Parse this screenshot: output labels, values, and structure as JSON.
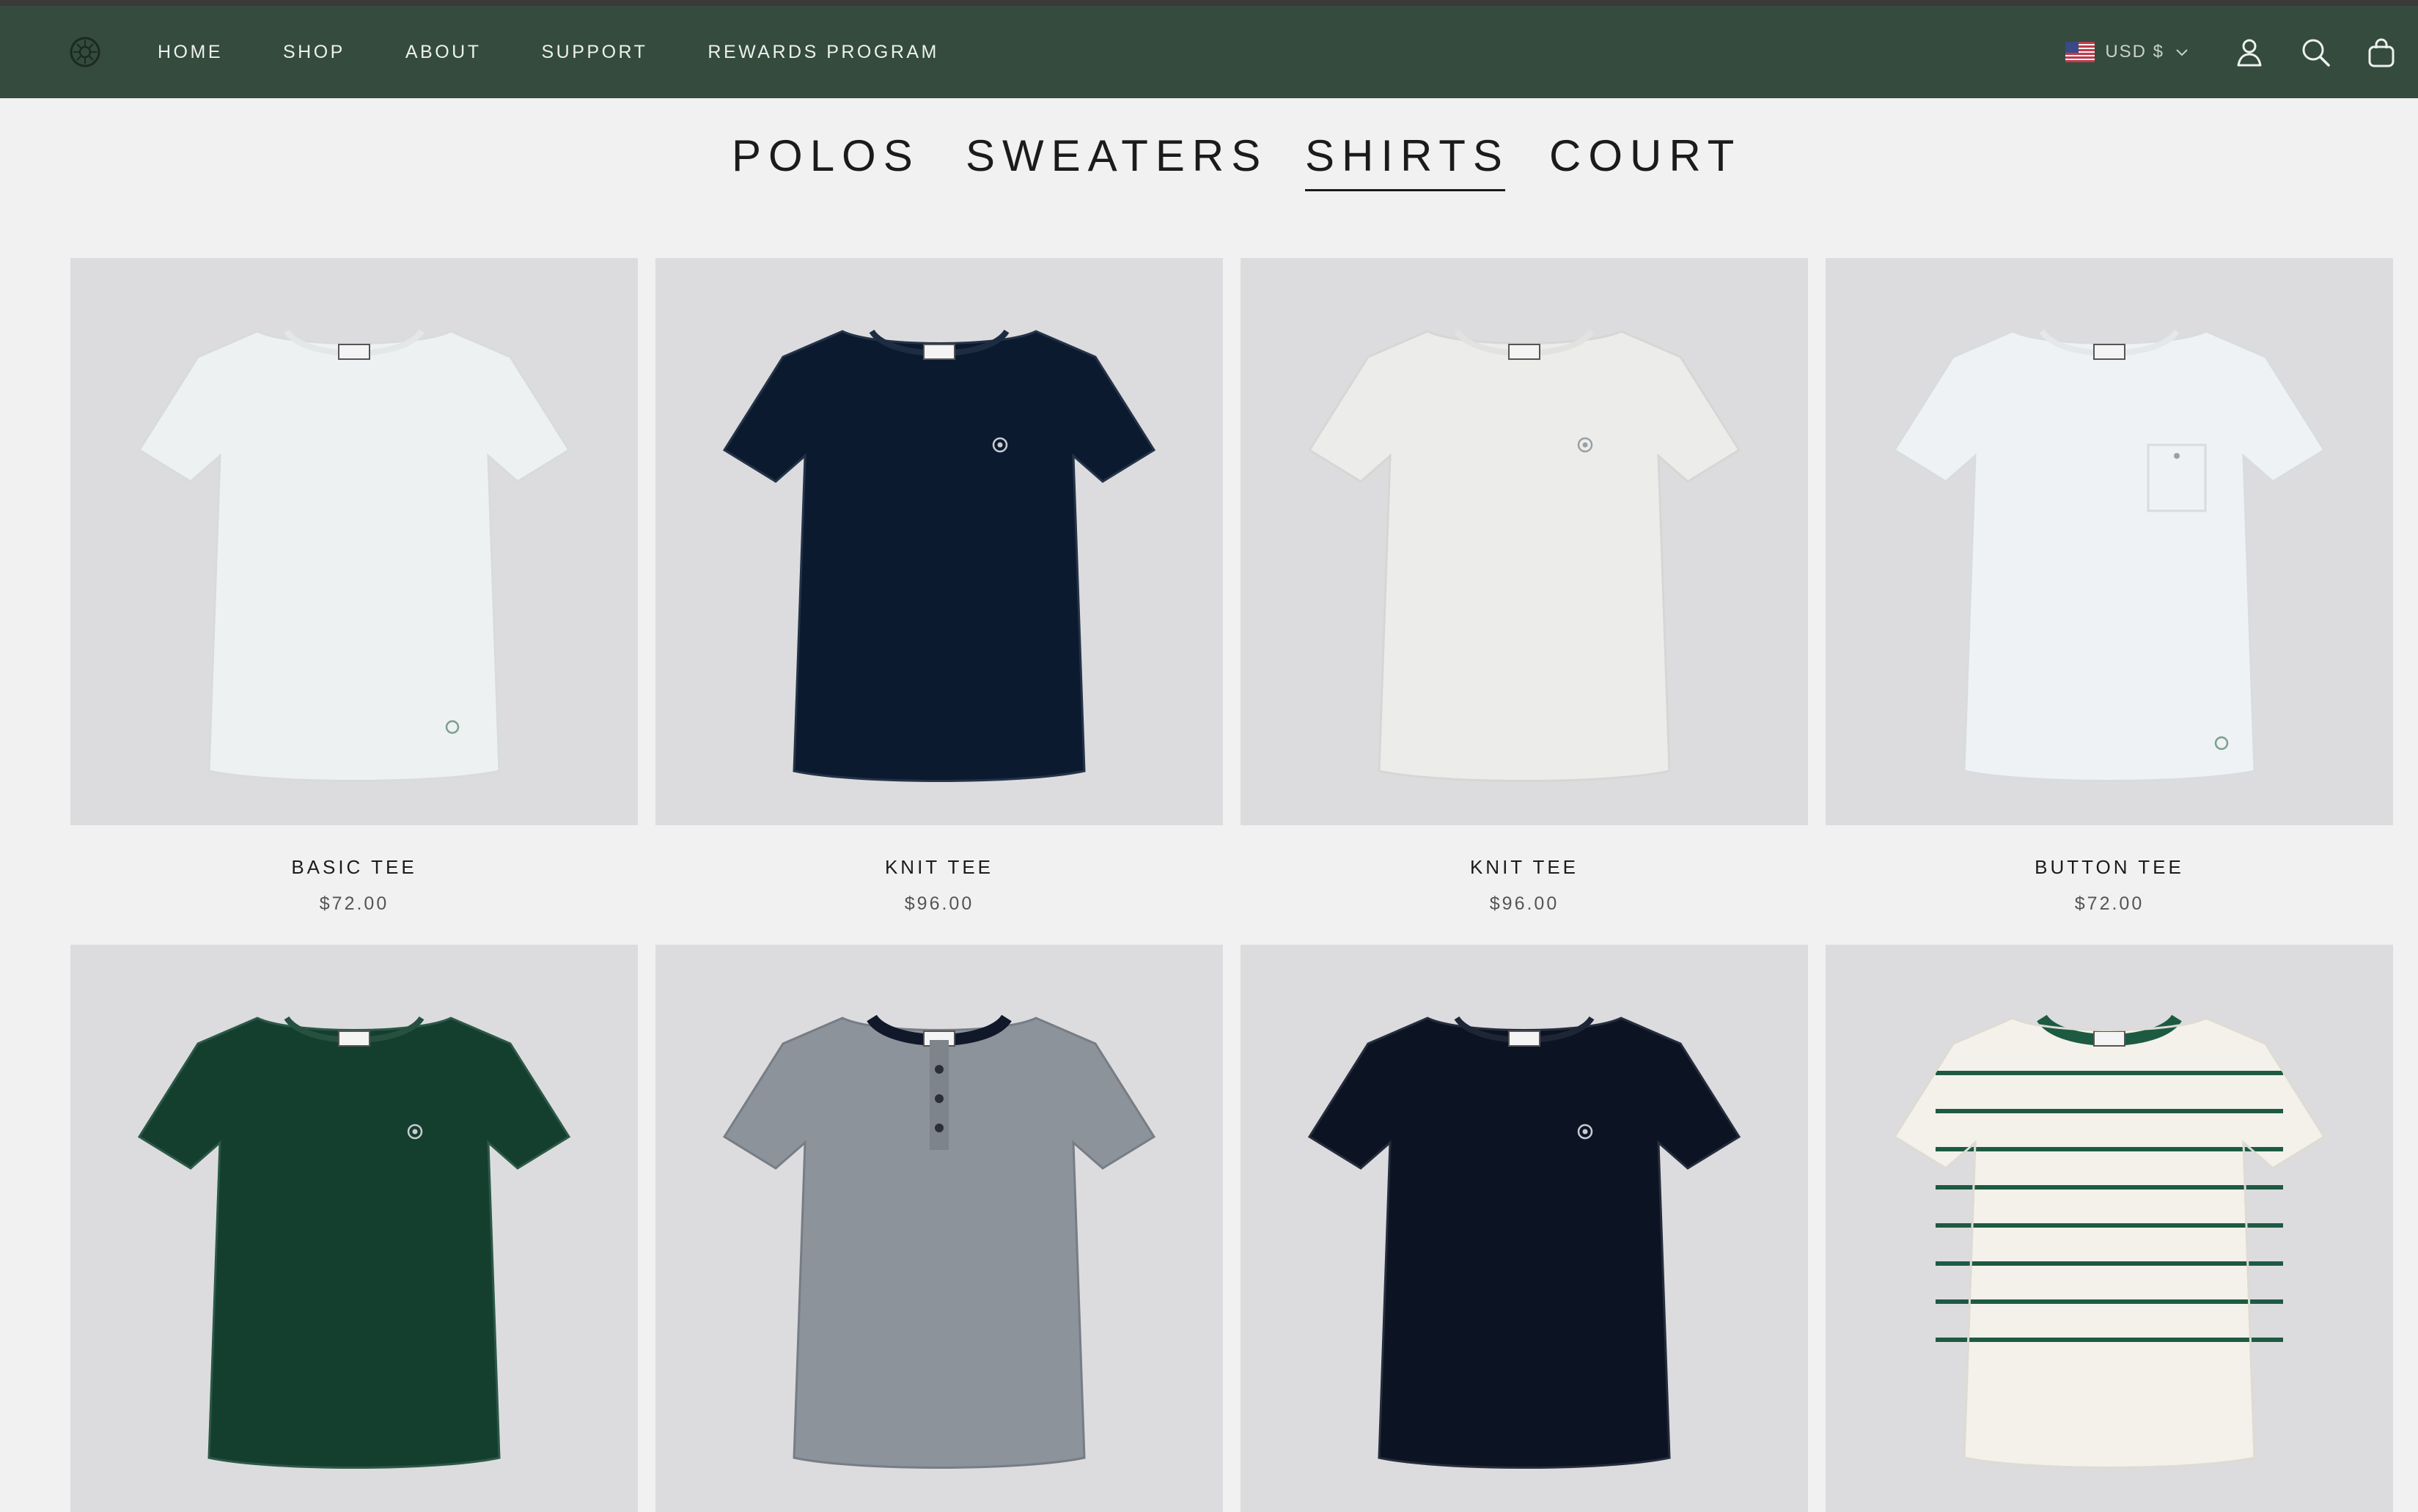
{
  "header": {
    "nav": [
      "HOME",
      "SHOP",
      "ABOUT",
      "SUPPORT",
      "REWARDS PROGRAM"
    ],
    "currency": "USD $",
    "bg_color": "#344b3e"
  },
  "categories": {
    "items": [
      "POLOS",
      "SWEATERS",
      "SHIRTS",
      "COURT"
    ],
    "active": "SHIRTS"
  },
  "products": [
    {
      "name": "BASIC TEE",
      "price": "$72.00",
      "color": "#eef1f2",
      "style": "basic"
    },
    {
      "name": "KNIT TEE",
      "price": "$96.00",
      "color": "#0b1a2e",
      "style": "knit"
    },
    {
      "name": "KNIT TEE",
      "price": "$96.00",
      "color": "#ecedea",
      "style": "knit"
    },
    {
      "name": "BUTTON TEE",
      "price": "$72.00",
      "color": "#eef2f5",
      "style": "pocket"
    },
    {
      "name": "",
      "price": "",
      "color": "#143f2e",
      "style": "knit"
    },
    {
      "name": "",
      "price": "",
      "color": "#8d939b",
      "style": "henley"
    },
    {
      "name": "",
      "price": "",
      "color": "#0c1424",
      "style": "knit"
    },
    {
      "name": "",
      "price": "",
      "color": "#f3f1ea",
      "style": "stripe"
    }
  ]
}
